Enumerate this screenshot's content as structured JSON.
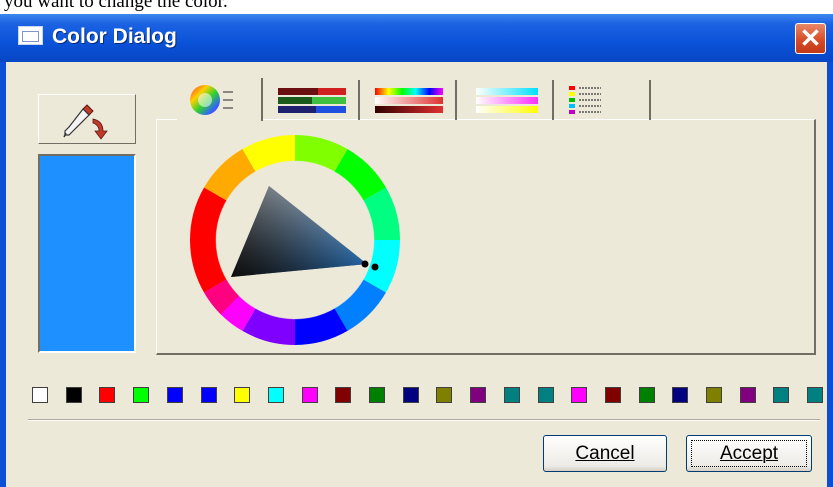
{
  "caption": {
    "text": "you want to change the color."
  },
  "window": {
    "title": "Color Dialog",
    "close_glyph": "✕"
  },
  "current_color": "#1e90ff",
  "tabs": [
    {
      "icon": "color-wheel-tab-icon",
      "selected": true
    },
    {
      "icon": "rgb-sliders-tab-icon",
      "selected": false
    },
    {
      "icon": "hsv-sliders-tab-icon",
      "selected": false
    },
    {
      "icon": "cmy-sliders-tab-icon",
      "selected": false
    },
    {
      "icon": "swatch-list-tab-icon",
      "selected": false
    }
  ],
  "palette": [
    "#ffffff",
    "#000000",
    "#ff0000",
    "#00ff00",
    "#0000ff",
    "#0000ff",
    "#ffff00",
    "#00ffff",
    "#ff00ff",
    "#800000",
    "#008000",
    "#000080",
    "#808000",
    "#800080",
    "#008080",
    "#008080",
    "#ff00ff",
    "#800000",
    "#008000",
    "#000080",
    "#808000",
    "#800080",
    "#008080",
    "#008080"
  ],
  "buttons": {
    "cancel": "Cancel",
    "accept": "Accept"
  },
  "colors": {
    "title_bar": "#0a52d8",
    "dialog_bg": "#ece9d8",
    "close_button": "#d84c25"
  }
}
